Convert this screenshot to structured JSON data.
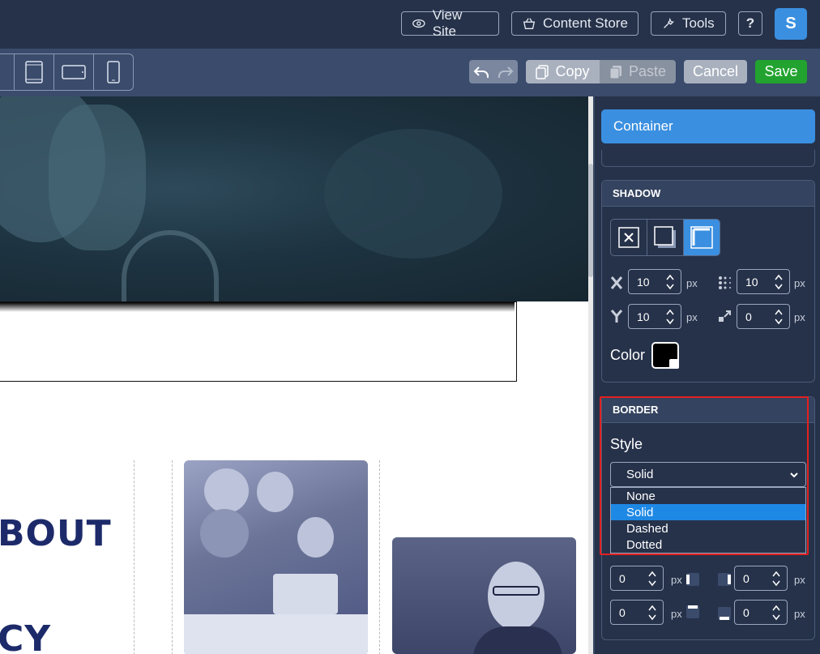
{
  "topbar": {
    "view_site": "View Site",
    "content_store": "Content Store",
    "tools": "Tools",
    "help": "?",
    "avatar_initial": "S"
  },
  "toolbar": {
    "copy": "Copy",
    "paste": "Paste",
    "cancel": "Cancel",
    "save": "Save"
  },
  "canvas": {
    "heading_1": "BOUT",
    "heading_2": "CY"
  },
  "panel": {
    "container_title": "Container",
    "shadow": {
      "title": "SHADOW",
      "x": "10",
      "blur": "10",
      "y": "10",
      "spread": "0",
      "unit": "px",
      "color_label": "Color",
      "color": "#000000"
    },
    "border": {
      "title": "BORDER",
      "style_label": "Style",
      "selected": "Solid",
      "options": [
        "None",
        "Solid",
        "Dashed",
        "Dotted"
      ],
      "left": "0",
      "right": "0",
      "top": "0",
      "bottom": "0",
      "unit": "px"
    }
  },
  "colors": {
    "accent": "#3a8fe0",
    "save": "#22a32f",
    "highlight": "#e32020",
    "topbar": "#26324a"
  }
}
